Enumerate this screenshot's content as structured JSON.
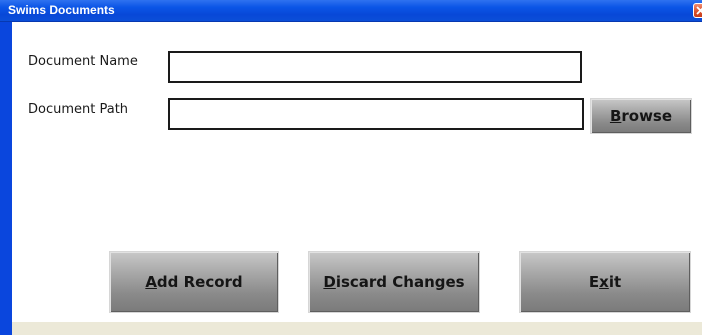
{
  "window": {
    "title": "Swims Documents",
    "close_icon": "close-icon"
  },
  "form": {
    "document_name_label": "Document Name",
    "document_name_value": "",
    "document_path_label": "Document Path",
    "document_path_value": ""
  },
  "buttons": {
    "browse": {
      "mnemonic": "B",
      "rest": "rowse"
    },
    "add_record": {
      "mnemonic": "A",
      "rest": "dd Record"
    },
    "discard_changes": {
      "mnemonic": "D",
      "rest": "iscard Changes"
    },
    "exit": {
      "pre": "E",
      "mnemonic": "x",
      "rest": "it"
    }
  },
  "colors": {
    "titlebar": "#0b55e6",
    "window_frame": "#0a46dd",
    "panel": "#ffffff",
    "button_face": "#a8a8a8",
    "close_button": "#d9502b"
  }
}
